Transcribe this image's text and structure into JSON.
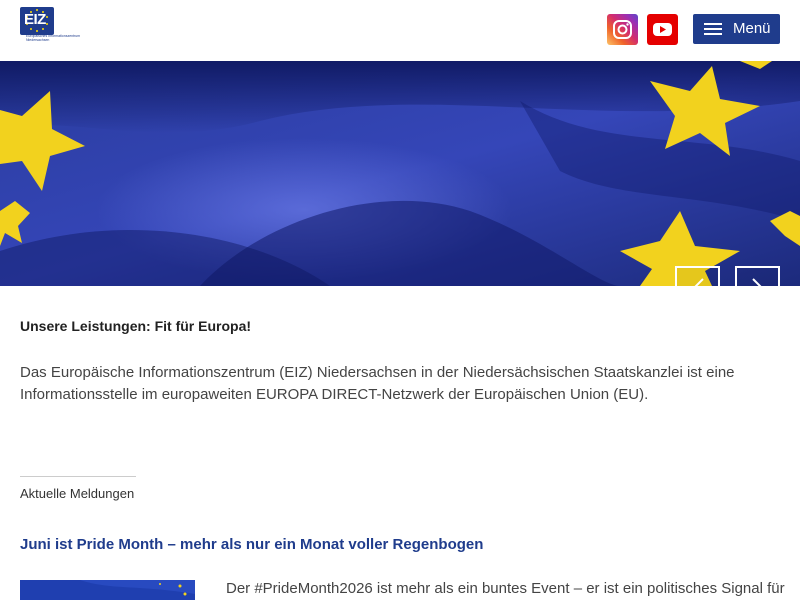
{
  "header": {
    "logo_text": "EIZ",
    "logo_subtext": "Europäisches Informationszentrum Niedersachsen",
    "menu_label": "Menü",
    "instagram_icon": "instagram-icon",
    "youtube_icon": "youtube-icon",
    "colors": {
      "brand": "#1f3c8c",
      "youtube": "#e50000"
    }
  },
  "hero": {
    "prev_icon": "chevron-left-icon",
    "next_icon": "chevron-right-icon"
  },
  "main": {
    "services_title": "Unsere Leistungen: Fit für Europa!",
    "intro_text": "Das Europäische Informationszentrum (EIZ) Niedersachsen in der Niedersächsischen Staatskanzlei ist eine Informationsstelle im europaweiten EUROPA DIRECT-Netzwerk der Europäischen Union (EU).",
    "news_section_label": "Aktuelle Meldungen",
    "news": [
      {
        "title": "Juni ist Pride Month – mehr als nur ein Monat voller Regenbogen",
        "teaser": "Der #PrideMonth2026 ist mehr als ein buntes Event – er ist ein politisches Signal für"
      }
    ]
  }
}
